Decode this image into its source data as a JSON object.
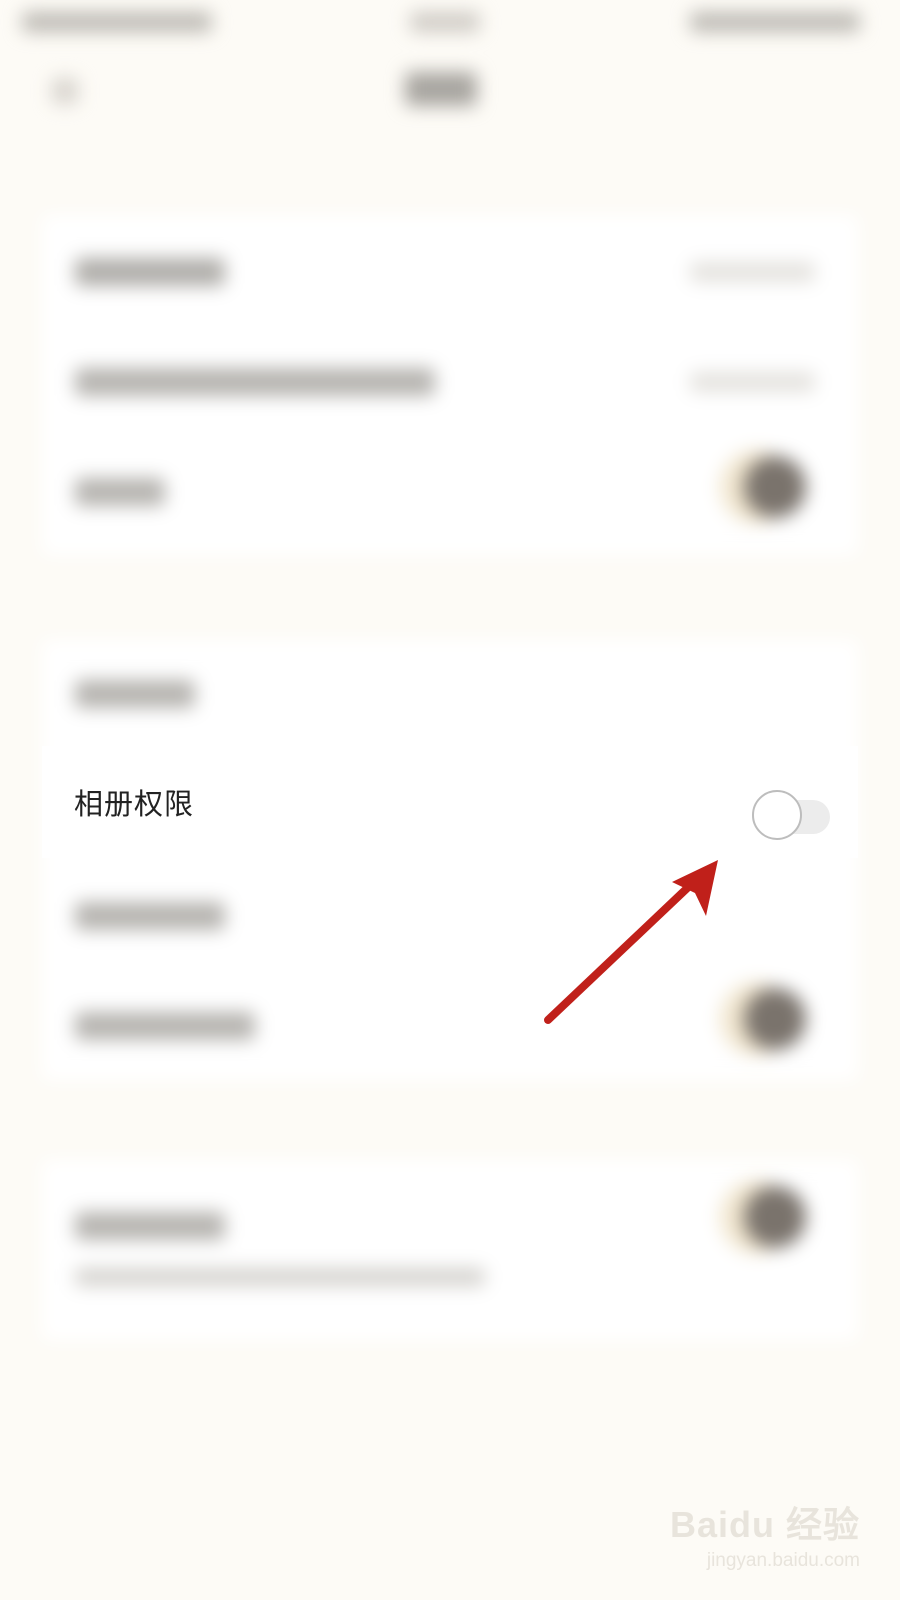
{
  "permission_row": {
    "label": "相册权限",
    "toggle_enabled": false
  },
  "watermark": {
    "logo": "Baidu 经验",
    "url": "jingyan.baidu.com"
  },
  "colors": {
    "background": "#fdfbf6",
    "arrow": "#c0201a",
    "toggle_track": "#ececec"
  }
}
